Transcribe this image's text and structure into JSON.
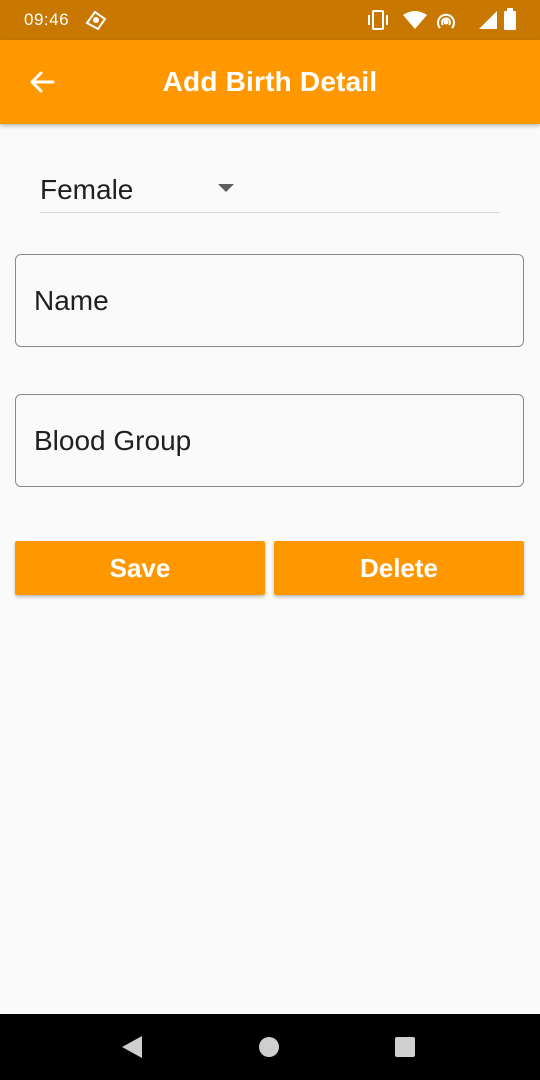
{
  "status_bar": {
    "time": "09:46",
    "icons": [
      "pokemon-go-icon",
      "vibrate-icon",
      "wifi-icon",
      "hotspot-icon",
      "signal-icon",
      "battery-icon"
    ]
  },
  "app_bar": {
    "title": "Add Birth Detail",
    "back_icon": "arrow-back-icon",
    "background_color": "#ff9800"
  },
  "form": {
    "gender": {
      "selected": "Female"
    },
    "name_field": {
      "placeholder": "Name",
      "value": ""
    },
    "blood_group_field": {
      "placeholder": "Blood Group",
      "value": ""
    }
  },
  "actions": {
    "save_label": "Save",
    "delete_label": "Delete"
  },
  "nav_bar": {
    "icons": [
      "back-triangle-icon",
      "home-circle-icon",
      "recents-square-icon"
    ]
  }
}
